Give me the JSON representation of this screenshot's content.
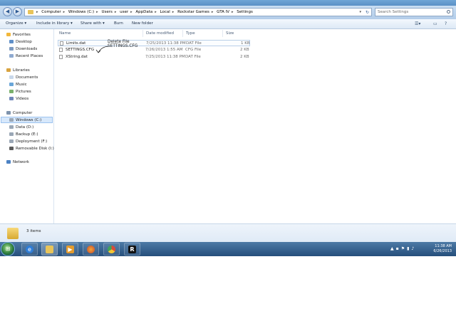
{
  "address_bar": {
    "crumbs": [
      "Computer",
      "Windows (C:)",
      "Users",
      "user",
      "AppData",
      "Local",
      "Rockstar Games",
      "GTA IV",
      "Settings"
    ]
  },
  "search": {
    "placeholder": "Search Settings"
  },
  "toolbar": {
    "organize": "Organize ▾",
    "include_in_library": "Include in library ▾",
    "share_with": "Share with ▾",
    "burn": "Burn",
    "new_folder": "New folder"
  },
  "nav": {
    "favorites": {
      "label": "Favorites",
      "items": [
        "Desktop",
        "Downloads",
        "Recent Places"
      ]
    },
    "libraries": {
      "label": "Libraries",
      "items": [
        "Documents",
        "Music",
        "Pictures",
        "Videos"
      ]
    },
    "computer": {
      "label": "Computer",
      "items": [
        "Windows (C:)",
        "Data (D:)",
        "Backup (E:)",
        "Deployment (F:)",
        "Removable Disk (I:)"
      ]
    },
    "network": {
      "label": "Network"
    }
  },
  "columns": {
    "name": "Name",
    "date": "Date modified",
    "type": "Type",
    "size": "Size"
  },
  "files": [
    {
      "name": "Limits.dat",
      "date": "7/25/2013 11:38 PM",
      "type": "DAT File",
      "size": "1 KB"
    },
    {
      "name": "SETTINGS.CFG",
      "date": "7/26/2013 1:55 AM",
      "type": "CFG File",
      "size": "2 KB"
    },
    {
      "name": "XString.dat",
      "date": "7/25/2013 11:38 PM",
      "type": "DAT File",
      "size": "2 KB"
    }
  ],
  "annotation": {
    "line1": "Delete File",
    "line2": "SETTINGS.CFG"
  },
  "details": {
    "count": "3 items"
  },
  "taskbar": {
    "time": "11:38 AM",
    "date": "6/26/2013"
  },
  "colors": {
    "taskbar": "#2f5a88",
    "selection": "#d7e8fb",
    "folder": "#e8c45a"
  }
}
